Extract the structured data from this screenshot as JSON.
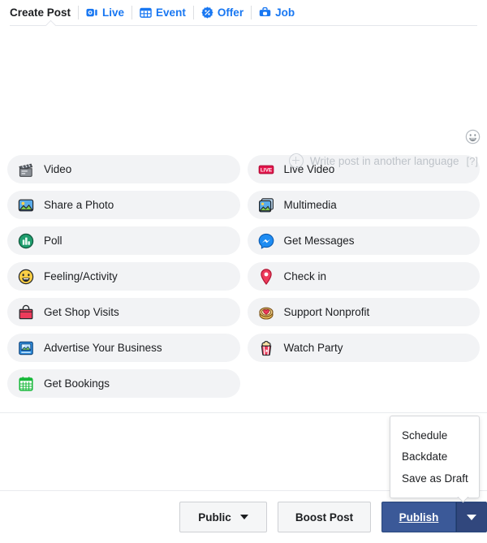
{
  "tabs": [
    {
      "label": "Create Post",
      "icon": "none",
      "active": true
    },
    {
      "label": "Live",
      "icon": "live-camera-icon",
      "active": false
    },
    {
      "label": "Event",
      "icon": "calendar-grid-icon",
      "active": false
    },
    {
      "label": "Offer",
      "icon": "percent-badge-icon",
      "active": false
    },
    {
      "label": "Job",
      "icon": "briefcase-icon",
      "active": false
    }
  ],
  "composer": {
    "placeholder": "",
    "value": "",
    "emoji_icon": "smiley-face-icon",
    "language_link": "Write post in another language",
    "language_help": "[?]",
    "plus_icon": "plus-circle-icon"
  },
  "options": {
    "left": [
      {
        "label": "Video",
        "icon": "clapperboard-icon"
      },
      {
        "label": "Share a Photo",
        "icon": "photo-icon"
      },
      {
        "label": "Poll",
        "icon": "poll-chart-icon"
      },
      {
        "label": "Feeling/Activity",
        "icon": "smiley-emoji-icon"
      },
      {
        "label": "Get Shop Visits",
        "icon": "shopping-bag-icon"
      },
      {
        "label": "Advertise Your Business",
        "icon": "advertise-frame-icon"
      },
      {
        "label": "Get Bookings",
        "icon": "calendar-icon"
      }
    ],
    "right": [
      {
        "label": "Live Video",
        "icon": "live-badge-icon"
      },
      {
        "label": "Multimedia",
        "icon": "multimedia-stack-icon"
      },
      {
        "label": "Get Messages",
        "icon": "messenger-icon"
      },
      {
        "label": "Check in",
        "icon": "location-pin-icon"
      },
      {
        "label": "Support Nonprofit",
        "icon": "nonprofit-heart-icon"
      },
      {
        "label": "Watch Party",
        "icon": "popcorn-icon"
      }
    ]
  },
  "menu": {
    "items": [
      {
        "label": "Schedule"
      },
      {
        "label": "Backdate"
      },
      {
        "label": "Save as Draft"
      }
    ]
  },
  "footer": {
    "audience_label": "Public",
    "audience_caret": "chevron-down-icon",
    "boost_label": "Boost Post",
    "publish_label": "Publish",
    "publish_caret": "chevron-down-icon"
  },
  "colors": {
    "tab_link_blue": "#1877f2",
    "publish_blue": "#3b5998",
    "publish_caret_blue": "#31477d",
    "pill_gray": "#f2f3f5",
    "text_primary": "#1c1e21",
    "muted_text": "#bec3c9"
  }
}
